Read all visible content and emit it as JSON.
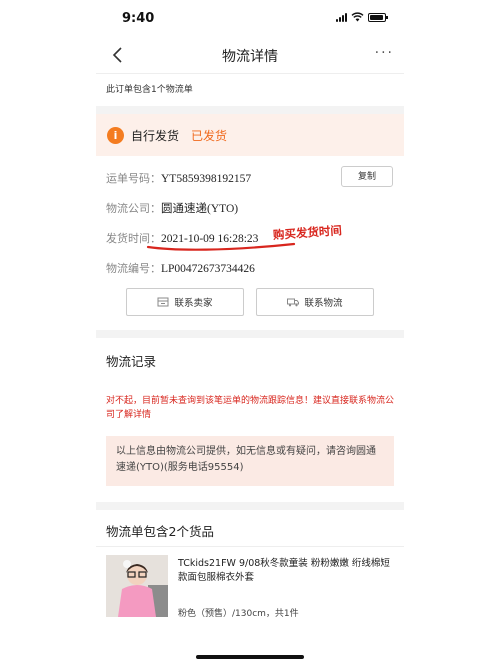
{
  "status_bar": {
    "time": "9:40"
  },
  "nav": {
    "title": "物流详情",
    "more": "···"
  },
  "notice": "此订单包含1个物流单",
  "shipment": {
    "method": "自行发货",
    "status": "已发货",
    "info_icon_glyph": "i",
    "accent_color": "#f06a1e",
    "rows": [
      {
        "label": "运单号码：",
        "value": "YT5859398192157"
      },
      {
        "label": "物流公司：",
        "value": "圆通速递(YTO)"
      },
      {
        "label": "发货时间：",
        "value": "2021-10-09 16:28:23"
      },
      {
        "label": "物流编号：",
        "value": "LP00472673734426"
      }
    ],
    "copy_button": "复制",
    "handwritten_note": "购买发货时间",
    "contact_seller": "联系卖家",
    "contact_logistics": "联系物流"
  },
  "logistics_record": {
    "title": "物流记录",
    "error_message": "对不起，目前暂未查询到该笔运单的物流跟踪信息！建议直接联系物流公司了解详情",
    "info_text": "以上信息由物流公司提供，如无信息或有疑问，请咨询圆通速递(YTO)(服务电话95554)"
  },
  "goods": {
    "title": "物流单包含2个货品",
    "items": [
      {
        "title": "TCkids21FW 9/08秋冬款童装 粉粉嫩嫩 绗线棉短款面包服棉衣外套",
        "spec": "粉色（预售）/130cm，共1件"
      }
    ]
  },
  "icons": {
    "back": "chevron-left-icon",
    "shop": "shop-icon",
    "truck": "truck-icon",
    "info": "info-icon"
  }
}
